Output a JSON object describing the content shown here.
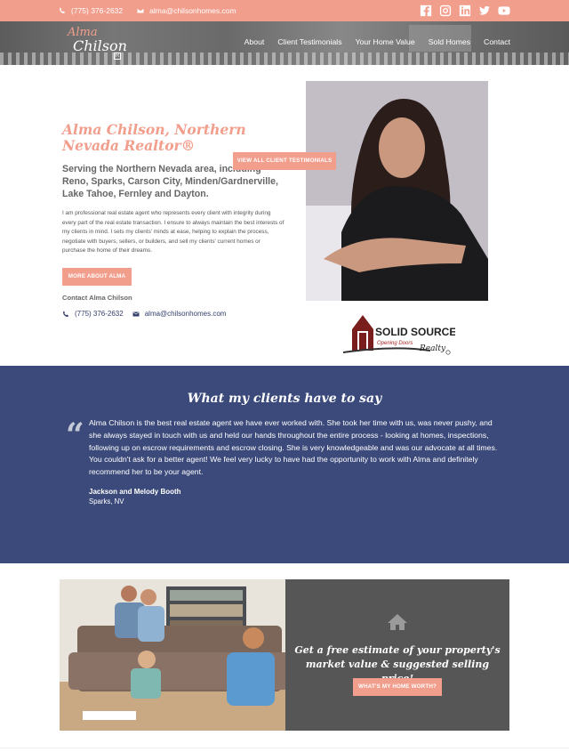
{
  "topbar": {
    "phone": "(775) 376-2632",
    "email": "alma@chilsonhomes.com",
    "social": [
      "facebook-icon",
      "instagram-icon",
      "linkedin-icon",
      "twitter-icon",
      "youtube-icon"
    ]
  },
  "logo": {
    "line1": "Alma",
    "line2": "Chilson",
    "badge": "R"
  },
  "nav": {
    "items": [
      "About",
      "Client Testimonials",
      "Your Home Value",
      "Sold Homes",
      "Contact"
    ]
  },
  "hero": {
    "title": "Alma Chilson, Northern Nevada Realtor®",
    "subtitle": "Serving the Northern Nevada area, including Reno, Sparks, Carson City, Minden/Gardnerville, Lake Tahoe, Fernley and Dayton.",
    "body": "I am professional real estate agent who represents every client with integrity during every part of the real estate transaction. I ensure to always maintain the best interests of my clients in mind. I sets my clients' minds at ease, helping to explain the process, negotiate with buyers, sellers, or builders, and sell my clients' current homes or purchase the home of their dreams.",
    "button": "MORE ABOUT ALMA",
    "contact_heading": "Contact Alma Chilson",
    "phone": "(775) 376-2632",
    "email": "alma@chilsonhomes.com"
  },
  "broker": {
    "name": "SOLID SOURCE",
    "tagline": "Opening Doors",
    "script": "Realty"
  },
  "testimonials": {
    "title": "What my clients have to say",
    "quote": "Alma Chilson is the best real estate agent we have ever worked with. She took her time with us, was never pushy, and she always stayed in touch with us and held our hands throughout the entire process - looking at homes, inspections, following up on escrow requirements and escrow closing. She is very knowledgeable and was our advocate at all times. You couldn't ask for a better agent! We feel very lucky to have had the opportunity to work with Alma and definitely recommend her to be your agent.",
    "author": "Jackson and Melody Booth",
    "location": "Sparks, NV",
    "button": "VIEW ALL CLIENT TESTIMONIALS"
  },
  "estimate": {
    "title": "Get a free estimate of your property's market value & suggested selling price!",
    "button": "WHAT'S MY HOME WORTH?"
  },
  "colors": {
    "accent": "#f29e8d",
    "navy": "#3b4a7a",
    "gray_box": "#565656"
  }
}
